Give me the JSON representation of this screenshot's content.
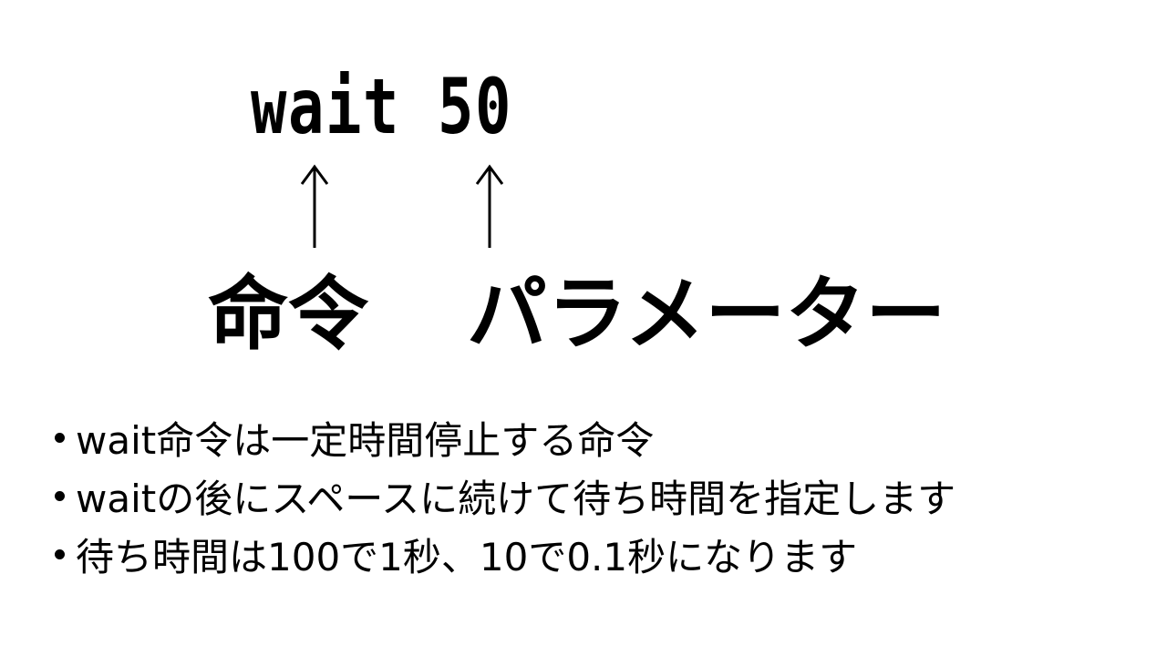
{
  "code": "wait 50",
  "labels": {
    "command": "命令",
    "parameter": "パラメーター"
  },
  "bullets": [
    "wait命令は一定時間停止する命令",
    "waitの後にスペースに続けて待ち時間を指定します",
    "待ち時間は100で1秒、10で0.1秒になります"
  ],
  "icons": {
    "arrow": "up-arrow-icon",
    "bullet": "bullet-dot-icon"
  },
  "colors": {
    "text": "#000000",
    "background": "#ffffff"
  }
}
